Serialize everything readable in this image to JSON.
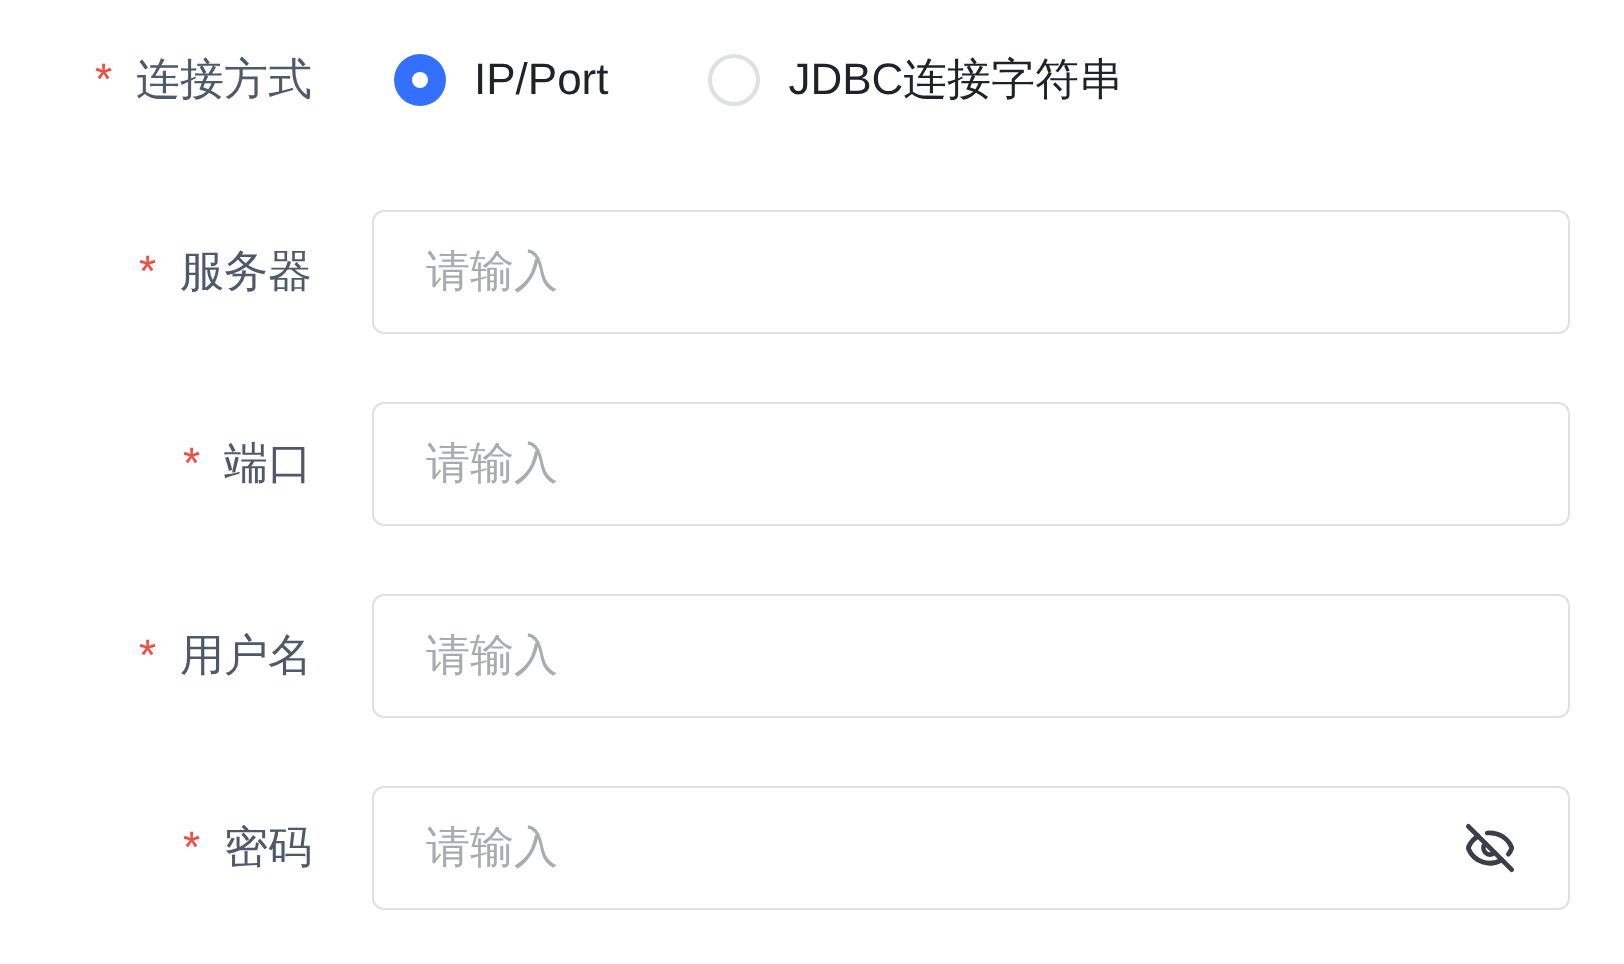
{
  "connection_mode": {
    "required_mark": "*",
    "label": "连接方式",
    "options": [
      {
        "label": "IP/Port",
        "selected": true
      },
      {
        "label": "JDBC连接字符串",
        "selected": false
      }
    ]
  },
  "fields": [
    {
      "kind": "text",
      "required_mark": "*",
      "label": "服务器",
      "placeholder": "请输入"
    },
    {
      "kind": "text",
      "required_mark": "*",
      "label": "端口",
      "placeholder": "请输入"
    },
    {
      "kind": "text",
      "required_mark": "*",
      "label": "用户名",
      "placeholder": "请输入"
    },
    {
      "kind": "password",
      "required_mark": "*",
      "label": "密码",
      "placeholder": "请输入"
    }
  ]
}
